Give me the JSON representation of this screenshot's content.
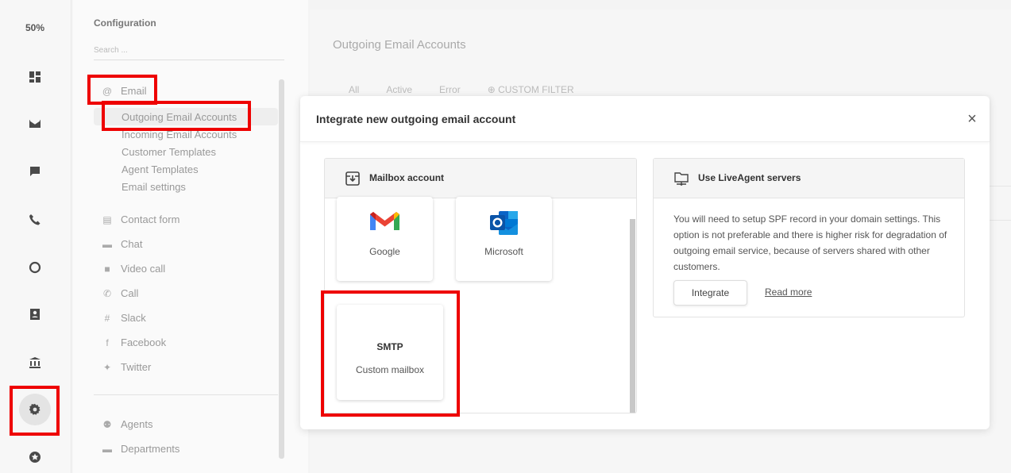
{
  "rail": {
    "zoom": "50%",
    "icons": [
      "dashboard-icon",
      "email-icon",
      "chat-icon",
      "phone-icon",
      "reports-icon",
      "contacts-icon",
      "knowledgebase-icon",
      "settings-icon",
      "plugins-icon"
    ]
  },
  "config": {
    "title": "Configuration",
    "search_placeholder": "Search ...",
    "email_group": "Email",
    "email_items": [
      "Outgoing Email Accounts",
      "Incoming Email Accounts",
      "Customer Templates",
      "Agent Templates",
      "Email settings"
    ],
    "channels": [
      "Contact form",
      "Chat",
      "Video call",
      "Call",
      "Slack",
      "Facebook",
      "Twitter"
    ],
    "people": [
      "Agents",
      "Departments"
    ]
  },
  "main": {
    "title": "Outgoing Email Accounts",
    "tabs": [
      "All",
      "Active",
      "Error",
      "CUSTOM FILTER"
    ]
  },
  "modal": {
    "title": "Integrate new outgoing email account",
    "close": "×",
    "mailbox": {
      "header": "Mailbox account",
      "tiles": [
        "Google",
        "Microsoft"
      ],
      "smtp_title": "SMTP",
      "smtp_desc": "Custom mailbox"
    },
    "liveagent": {
      "header": "Use LiveAgent servers",
      "description": "You will need to setup SPF record in your domain settings. This option is not preferable and there is higher risk for degradation of outgoing email service, because of servers shared with other customers.",
      "integrate": "Integrate",
      "read_more": "Read more"
    }
  },
  "colors": {
    "highlight": "#ee0000",
    "gmail_red": "#ea4335",
    "outlook_blue": "#0a64c6"
  }
}
